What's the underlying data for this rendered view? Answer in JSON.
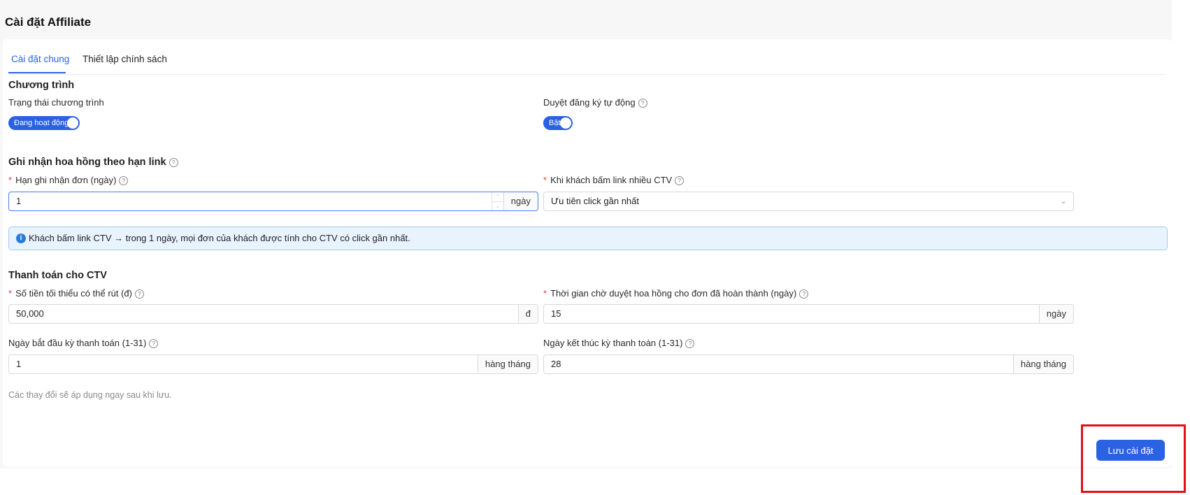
{
  "page": {
    "title": "Cài đặt Affiliate"
  },
  "tabs": [
    {
      "label": "Cài đặt chung",
      "active": true
    },
    {
      "label": "Thiết lập chính sách",
      "active": false
    }
  ],
  "program": {
    "title": "Chương trình",
    "status_label": "Trạng thái chương trình",
    "status_value": "Đang hoạt động",
    "auto_approve_label": "Duyệt đăng ký tự động",
    "auto_approve_value": "Bật"
  },
  "commission": {
    "title": "Ghi nhận hoa hồng theo hạn link",
    "window_label": "Hạn ghi nhận đơn (ngày)",
    "window_value": "1",
    "window_unit": "ngày",
    "multi_click_label": "Khi khách bấm link nhiều CTV",
    "multi_click_value": "Ưu tiên click gần nhất",
    "info_text": "Khách bấm link CTV → trong 1 ngày, mọi đơn của khách được tính cho CTV có click gần nhất."
  },
  "payment": {
    "title": "Thanh toán cho CTV",
    "min_withdraw_label": "Số tiền tối thiểu có thể rút (đ)",
    "min_withdraw_value": "50,000",
    "min_withdraw_unit": "đ",
    "hold_label": "Thời gian chờ duyệt hoa hồng cho đơn đã hoàn thành (ngày)",
    "hold_value": "15",
    "hold_unit": "ngày",
    "start_label": "Ngày bắt đầu kỳ thanh toán (1-31)",
    "start_value": "1",
    "start_unit": "hàng tháng",
    "end_label": "Ngày kết thúc kỳ thanh toán (1-31)",
    "end_value": "28",
    "end_unit": "hàng tháng"
  },
  "footer": {
    "note": "Các thay đổi sẽ áp dụng ngay sau khi lưu.",
    "save_label": "Lưu cài đặt"
  },
  "colors": {
    "accent": "#2a62e3",
    "highlight": "#e0101a",
    "info_bg": "#e8f3fe"
  }
}
